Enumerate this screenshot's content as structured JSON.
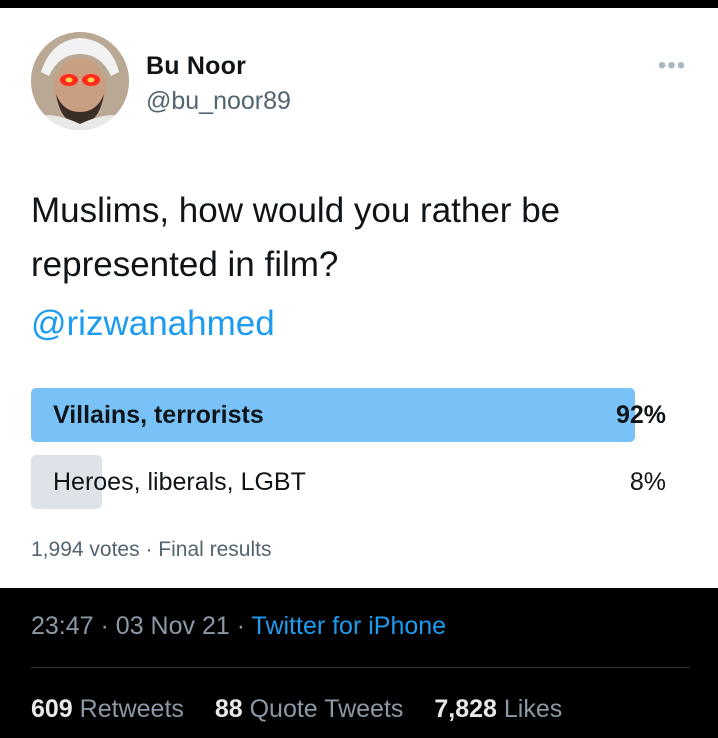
{
  "author": {
    "name": "Bu Noor",
    "handle": "@bu_noor89"
  },
  "tweet": {
    "text": "Muslims, how would you rather be represented in film?",
    "mention": "@rizwanahmed"
  },
  "poll": {
    "options": [
      {
        "label": "Villains, terrorists",
        "percent_text": "92%",
        "fraction": 0.92,
        "winner": true
      },
      {
        "label": "Heroes, liberals, LGBT",
        "percent_text": "8%",
        "fraction": 0.08,
        "winner": false
      }
    ],
    "votes_text": "1,994 votes",
    "separator": "·",
    "status": "Final results",
    "winner_color": "#79c2f8",
    "other_color": "#dde3e8"
  },
  "meta": {
    "time": "23:47",
    "date": "03 Nov 21",
    "separator": "·",
    "source": "Twitter for iPhone"
  },
  "stats": {
    "retweets_count": "609",
    "retweets_label": "Retweets",
    "quotes_count": "88",
    "quotes_label": "Quote Tweets",
    "likes_count": "7,828",
    "likes_label": "Likes"
  },
  "colors": {
    "accent": "#1d9bf0",
    "dark_bg": "#000000",
    "card_bg": "#ffffff"
  },
  "icons": {
    "more": "more-horizontal-icon"
  }
}
